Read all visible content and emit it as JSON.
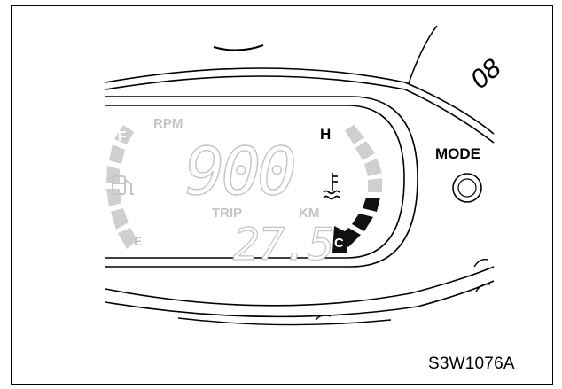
{
  "figure": {
    "id_label": "S3W1076A"
  },
  "display": {
    "rpm_label": "RPM",
    "rpm_value": "900",
    "trip_label": "TRIP",
    "km_label": "KM",
    "trip_value": "27.5",
    "fuel_full_label": "F",
    "fuel_empty_label": "E",
    "temp_hot_label": "H",
    "temp_cold_label": "C"
  },
  "controls": {
    "mode_label": "MODE"
  },
  "speedo_fragment": "08",
  "gauges": {
    "temperature_segments_lit": 3,
    "temperature_segments_total": 8,
    "fuel_segments_total": 5
  },
  "colors": {
    "lit": "#111111",
    "unlit": "#cfcfcf",
    "faint_text": "#c4c4c4",
    "line": "#000000"
  }
}
